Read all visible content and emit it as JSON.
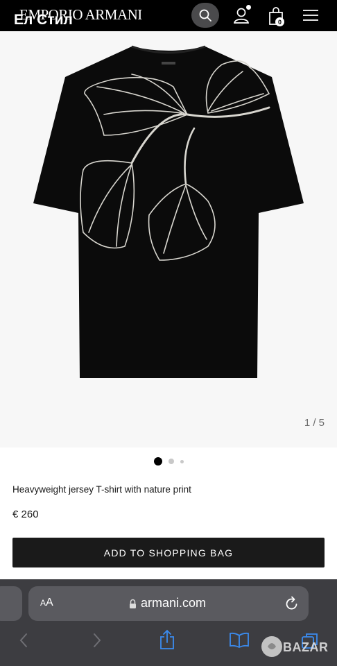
{
  "header": {
    "logo": "EMPORIO ARMANI",
    "watermark": "Ел Стил",
    "bag_count": "0",
    "icons": [
      "search-icon",
      "account-icon",
      "bag-icon",
      "menu-icon"
    ]
  },
  "gallery": {
    "counter": "1 / 5",
    "active_dot": 1
  },
  "product": {
    "name": "Heavyweight jersey T-shirt with nature print",
    "price": "€ 260",
    "add_to_bag": "ADD TO SHOPPING BAG"
  },
  "browser": {
    "text_size_small": "A",
    "text_size_large": "A",
    "domain": "armani.com",
    "icons": [
      "lock-icon",
      "reload-icon",
      "back-icon",
      "forward-icon",
      "share-icon",
      "bookmarks-icon",
      "tabs-icon"
    ]
  },
  "overlay": {
    "badge": "BAZAR"
  },
  "colors": {
    "header_bg": "#000000",
    "button_bg": "#1a1a1a",
    "safari_bg": "#3d3d41"
  }
}
